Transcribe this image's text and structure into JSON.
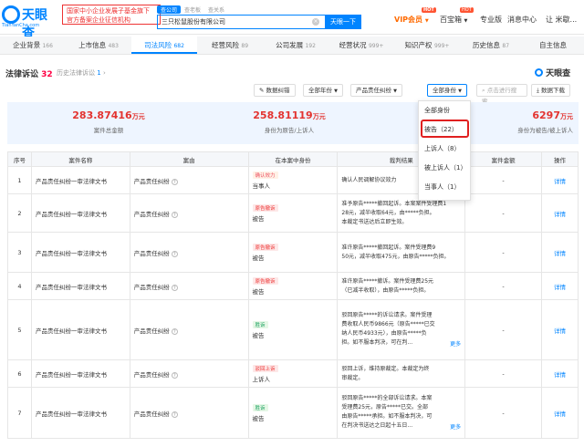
{
  "header": {
    "logo_text": "天眼查",
    "logo_sub": "TianYanCha.com",
    "banner_line1": "国家中小企业发展子基金旗下",
    "banner_line2": "官方备案企业征信机构",
    "search_tabs": [
      "查公司",
      "查老板",
      "查关系"
    ],
    "search_value": "三只松鼠股份有限公司",
    "search_clear": "×",
    "search_button": "天眼一下",
    "nav": {
      "vip": "VIP会员",
      "vip_arrow": "▼",
      "hot1": "HOT",
      "baibao": "百宝箱",
      "baibao_arrow": "▼",
      "hot2": "HOT",
      "pro": "专业版",
      "messages": "消息中心",
      "user": "让 米歇..."
    }
  },
  "tabs": [
    {
      "label": "企业背景",
      "count": "166"
    },
    {
      "label": "上市信息",
      "count": "483"
    },
    {
      "label": "司法风险",
      "count": "682"
    },
    {
      "label": "经营风险",
      "count": "89"
    },
    {
      "label": "公司发展",
      "count": "192"
    },
    {
      "label": "经营状况",
      "count": "999+"
    },
    {
      "label": "知识产权",
      "count": "999+"
    },
    {
      "label": "历史信息",
      "count": "87"
    },
    {
      "label": "自主信息",
      "count": ""
    }
  ],
  "section": {
    "title": "法律诉讼",
    "count": "32",
    "history_prefix": "历史法律诉讼",
    "history_count": "1",
    "history_suffix": "›",
    "watermark": "天眼查"
  },
  "filters": {
    "data_error": "数据纠错",
    "all_years": "全部年份",
    "case_type": "产品责任纠纷",
    "all_identity": "全部身份",
    "search_placeholder": "点击进行搜索",
    "download": "数据下载"
  },
  "stats": [
    {
      "value": "283.87416",
      "unit": "万元",
      "label": "案件总金额"
    },
    {
      "value": "258.81119",
      "unit": "万元",
      "label": "身份为原告/上诉人"
    },
    {
      "value": "6297",
      "unit": "万元",
      "label": "身份为被告/被上诉人"
    }
  ],
  "dropdown": {
    "items": [
      "全部身份",
      "被告（22）",
      "上诉人（8）",
      "被上诉人（1）",
      "当事人（1）"
    ],
    "selected_index": 1
  },
  "table": {
    "headers": [
      "序号",
      "案件名称",
      "案由",
      "在本案中身份",
      "裁判结果",
      "案件金额",
      "操作"
    ],
    "rows": [
      {
        "no": "1",
        "name": "产品责任纠纷一审法律文书",
        "cause": "产品责任纠纷",
        "tag": "确认效力",
        "tag_color": "orange",
        "role": "当事人",
        "result": [
          "确认人民调解协议效力"
        ],
        "amount": "-",
        "op": "详情"
      },
      {
        "no": "2",
        "name": "产品责任纠纷一审法律文书",
        "cause": "产品责任纠纷",
        "tag": "原告撤诉",
        "tag_color": "red",
        "role": "被告",
        "result": [
          "准予原告*****撤回起诉。本案案件受理费1",
          "28元，减半收取64元，由*****负担。",
          "本裁定书送达后立即生效。"
        ],
        "amount": "-",
        "op": "详情"
      },
      {
        "no": "3",
        "name": "产品责任纠纷一审法律文书",
        "cause": "产品责任纠纷",
        "tag": "原告撤诉",
        "tag_color": "red",
        "role": "被告",
        "result": [
          "准许原告*****撤回起诉。案件受理费9",
          "50元，减半收取475元，由原告*****负担。"
        ],
        "amount": "-",
        "op": "详情"
      },
      {
        "no": "4",
        "name": "产品责任纠纷一审法律文书",
        "cause": "产品责任纠纷",
        "tag": "原告撤诉",
        "tag_color": "red",
        "role": "被告",
        "result": [
          "准许原告*****撤诉。案件受理费25元",
          "（已减半收取），由原告*****负担。"
        ],
        "amount": "-",
        "op": "详情"
      },
      {
        "no": "5",
        "name": "产品责任纠纷一审法律文书",
        "cause": "产品责任纠纷",
        "tag": "胜诉",
        "tag_color": "green",
        "role": "被告",
        "result": [
          "驳回原告*****的诉讼请求。案件受理",
          "费收取人民币9866元（原告*****已交",
          "纳人民币4933元），由原告*****负",
          "担。如不服本判决，可在判..."
        ],
        "amount": "-",
        "op": "详情",
        "more": "更多"
      },
      {
        "no": "6",
        "name": "产品责任纠纷一审法律文书",
        "cause": "产品责任纠纷",
        "tag": "驳回上诉",
        "tag_color": "red",
        "role": "上诉人",
        "result": [
          "驳回上诉，维持原裁定。本裁定为终",
          "审裁定。"
        ],
        "amount": "-",
        "op": "详情"
      },
      {
        "no": "7",
        "name": "产品责任纠纷一审法律文书",
        "cause": "产品责任纠纷",
        "tag": "胜诉",
        "tag_color": "green",
        "role": "被告",
        "result": [
          "驳回原告*****的全部诉讼请求。本案",
          "受理费25元，原告*****已交。全部",
          "由原告*****承担。如不服本判决，可",
          "在判决书送达之日起十五日..."
        ],
        "amount": "-",
        "op": "详情",
        "more": "更多"
      }
    ]
  },
  "icons": {
    "question": "?",
    "chevron": "▼",
    "search": "⌕",
    "download": "⤓",
    "edit": "✎"
  }
}
